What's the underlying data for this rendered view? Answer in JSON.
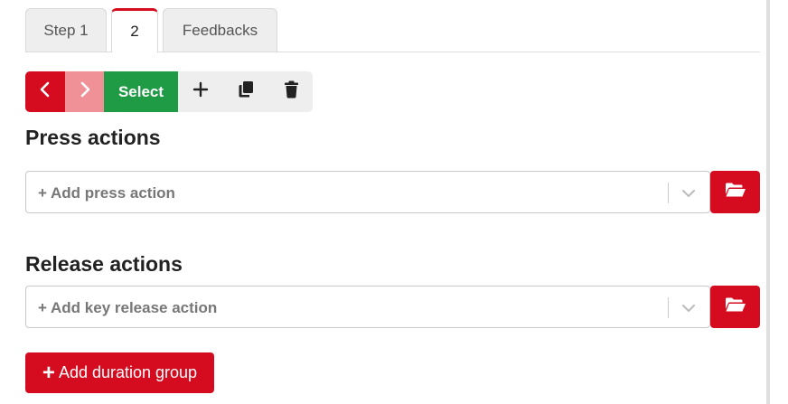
{
  "tabs": [
    {
      "label": "Step 1",
      "active": false
    },
    {
      "label": "2",
      "active": true
    },
    {
      "label": "Feedbacks",
      "active": false
    }
  ],
  "toolbar": {
    "prev_icon": "chevron-left-icon",
    "next_icon": "chevron-right-icon",
    "select_label": "Select",
    "add_icon": "plus-icon",
    "copy_icon": "copy-icon",
    "delete_icon": "trash-icon"
  },
  "press_actions": {
    "heading": "Press actions",
    "placeholder": "+ Add press action",
    "folder_icon": "folder-open-icon"
  },
  "release_actions": {
    "heading": "Release actions",
    "placeholder": "+ Add key release action",
    "folder_icon": "folder-open-icon"
  },
  "add_duration_group": {
    "icon": "plus",
    "label": "Add duration group"
  },
  "colors": {
    "brand_red": "#d50c1f",
    "brand_red_light": "#ef9196",
    "select_green": "#1f9a45"
  }
}
